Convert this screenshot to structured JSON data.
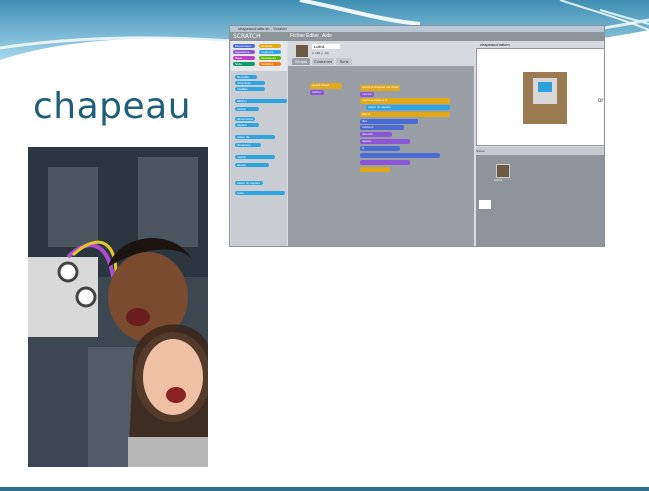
{
  "slide": {
    "title": "chapeau"
  },
  "colors": {
    "title": "#1f5f7a",
    "accent": "#2e6f8e"
  },
  "scratch": {
    "window_title": "chapeauchatto.sb - Scratch",
    "menu": [
      "Fichier",
      "Éditer",
      "Aide"
    ],
    "sprite_name": "Lutin1",
    "tabs": [
      "Scripts",
      "Costumes",
      "Sons"
    ],
    "stage_name": "chapeauchattom",
    "stage_text": "or",
    "coords": "x: 184  y: -64",
    "sprites": [
      "Lutin1"
    ],
    "stage_label": "Scène",
    "categories": [
      "Mouvement",
      "Contrôle",
      "Apparence",
      "Capteurs",
      "Sons",
      "Opérateurs",
      "Stylo",
      "Variables"
    ],
    "palette_blocks": [
      "Nouvelle",
      "renommer",
      "modifier",
      "afficher",
      "cacher",
      "déconnecter",
      "capteur",
      "valeur de",
      "dimension",
      "mettre",
      "ajouter",
      "valeur du capteur",
      "Lutin"
    ],
    "script_blocks": [
      "quand cliqué",
      "cacher",
      "quand le drapeau est cliqué",
      "montrer",
      "mettre le capteur à",
      "valeur du capteur",
      "aller à",
      "dire",
      "mettre à",
      "attendre",
      "répéter",
      "si"
    ]
  }
}
